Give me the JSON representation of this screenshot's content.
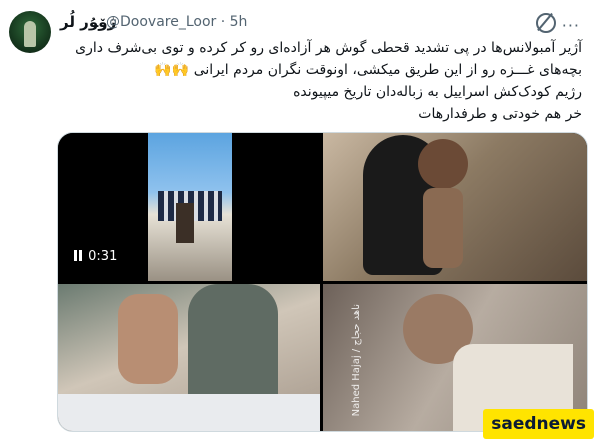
{
  "author": {
    "name": "ﮊۆﯘر لُر",
    "handle": "@Doovare_Loor",
    "time_sep": "·",
    "time": "5h"
  },
  "tweet": {
    "line1": "آژیر آمبولانس‌ها در پی تشدید قحطی گوش هر آزاده‌ای رو کر کرده و توی بی‌شرف داری",
    "line2": "بچه‌های غـــزه رو از این طریق میکشی، اونوقت نگران مردم ایرانی 🙌🙌",
    "line3": "رژیم کودک‌کش اسراییل به زباله‌دان تاریخ میپیونده",
    "line4": "خر هم خودتی و طرفدارهات"
  },
  "media": {
    "video_duration": "0:31",
    "photo_caption": "Nahed Hajaj / ناهد حجاج"
  },
  "watermark": "saednews",
  "colors": {
    "text": "#0f1419",
    "muted": "#536471",
    "border": "#cfd9de",
    "watermark_bg": "#ffe400"
  }
}
